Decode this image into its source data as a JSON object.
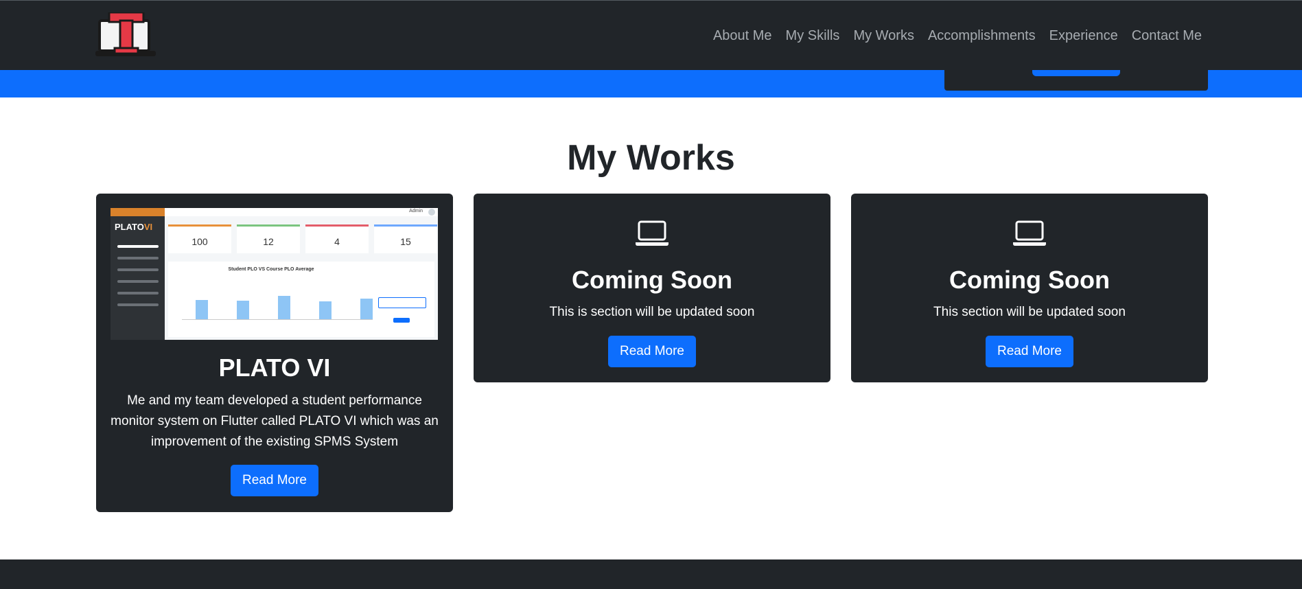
{
  "navbar": {
    "logo_alt": "T",
    "links": [
      "About Me",
      "My Skills",
      "My Works",
      "Accomplishments",
      "Experience",
      "Contact Me"
    ]
  },
  "section": {
    "title": "My Works"
  },
  "cards": [
    {
      "title": "PLATO VI",
      "text": "Me and my team developed a student performance monitor system on Flutter called PLATO VI which was an improvement of the existing SPMS System",
      "button": "Read More",
      "thumbnail": {
        "brand": "PLATO",
        "brand_suffix": "VI",
        "user": "Admin",
        "stats": [
          "100",
          "12",
          "4",
          "15"
        ],
        "chart_title": "Student PLO VS Course PLO Average"
      }
    },
    {
      "icon": "laptop-icon",
      "title": "Coming Soon",
      "text": "This is section will be updated soon",
      "button": "Read More"
    },
    {
      "icon": "laptop-icon",
      "title": "Coming Soon",
      "text": "This section will be updated soon",
      "button": "Read More"
    }
  ],
  "colors": {
    "primary": "#0d6efd",
    "dark": "#212529",
    "logo_red": "#e63946"
  }
}
